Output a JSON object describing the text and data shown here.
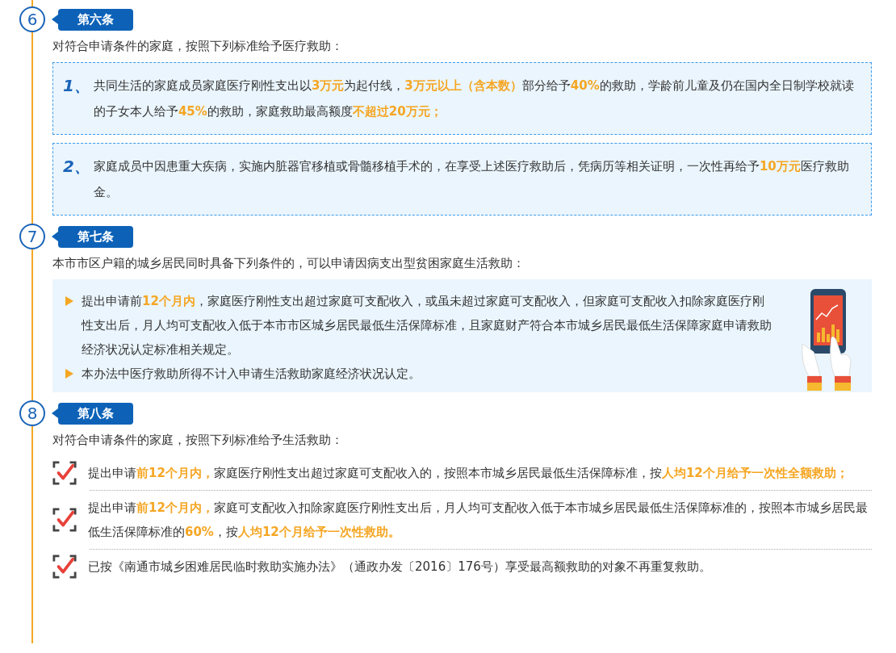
{
  "articles": [
    {
      "number": "6",
      "title": "第六条",
      "intro": "对符合申请条件的家庭，按照下列标准给予医疗救助：",
      "kind": "numbered",
      "items": [
        {
          "marker": "1、",
          "text": "共同生活的家庭成员家庭医疗刚性支出以**3万元**为起付线，**3万元以上（含本数）**部分给予**40%**的救助，学龄前儿童及仍在国内全日制学校就读的子女本人给予**45%**的救助，家庭救助最高额度**不超过20万元；**"
        },
        {
          "marker": "2、",
          "text": "家庭成员中因患重大疾病，实施内脏器官移植或骨髓移植手术的，在享受上述医疗救助后，凭病历等相关证明，一次性再给予**10万元**医疗救助金。"
        }
      ]
    },
    {
      "number": "7",
      "title": "第七条",
      "intro": "本市市区户籍的城乡居民同时具备下列条件的，可以申请因病支出型贫困家庭生活救助：",
      "kind": "bullets",
      "items": [
        {
          "text": "提出申请前**12个月内**，家庭医疗刚性支出超过家庭可支配收入，或虽未超过家庭可支配收入，但家庭可支配收入扣除家庭医疗刚性支出后，月人均可支配收入低于本市市区城乡居民最低生活保障标准，且家庭财产符合本市城乡居民最低生活保障家庭申请救助经济状况认定标准相关规定。"
        },
        {
          "text": "本办法中医疗救助所得不计入申请生活救助家庭经济状况认定。"
        }
      ]
    },
    {
      "number": "8",
      "title": "第八条",
      "intro": "对符合申请条件的家庭，按照下列标准给予生活救助：",
      "kind": "checks",
      "items": [
        {
          "text": "提出申请**前12个月内，**家庭医疗刚性支出超过家庭可支配收入的，按照本市城乡居民最低生活保障标准，按**人均12个月给予一次性全额救助；**"
        },
        {
          "text": "提出申请**前12个月内，**家庭可支配收入扣除家庭医疗刚性支出后，月人均可支配收入低于本市城乡居民最低生活保障标准的，按照本市城乡居民最低生活保障标准的**60%**，按**人均12个月给予一次性救助。**"
        },
        {
          "text": "已按《南通市城乡困难居民临时救助实施办法》（通政办发〔2016〕176号）享受最高额救助的对象不再重复救助。"
        }
      ]
    }
  ]
}
